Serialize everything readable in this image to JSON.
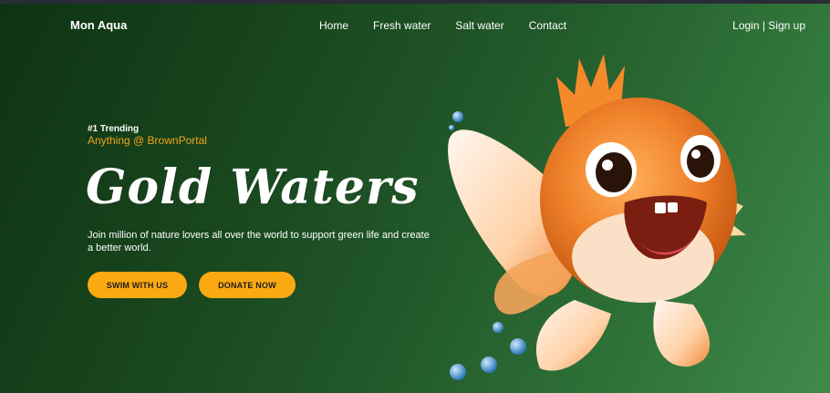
{
  "header": {
    "brand": "Mon Aqua",
    "nav": [
      {
        "label": "Home"
      },
      {
        "label": "Fresh water"
      },
      {
        "label": "Salt water"
      },
      {
        "label": "Contact"
      }
    ],
    "auth_label": "Login | Sign up"
  },
  "hero": {
    "tag": "#1 Trending",
    "subtitle": "Anything @ BrownPortal",
    "title": "Gold Waters",
    "description": "Join million of nature lovers all over the world to support green life and create a better world.",
    "primary_button": "SWIM WITH US",
    "secondary_button": "DONATE NOW"
  },
  "colors": {
    "accent": "#fba912",
    "subtitle": "#f5a31b",
    "bg_dark": "#0e3314",
    "bg_light": "#3f8a4b"
  },
  "icons": {
    "illustration": "goldfish-illustration"
  }
}
